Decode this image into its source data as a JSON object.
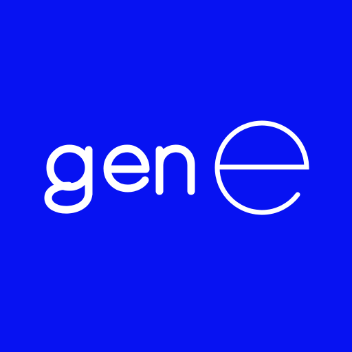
{
  "logo": {
    "wordmark": "gen",
    "mark": "e",
    "colors": {
      "background": "#0712f2",
      "foreground": "#ffffff"
    }
  }
}
